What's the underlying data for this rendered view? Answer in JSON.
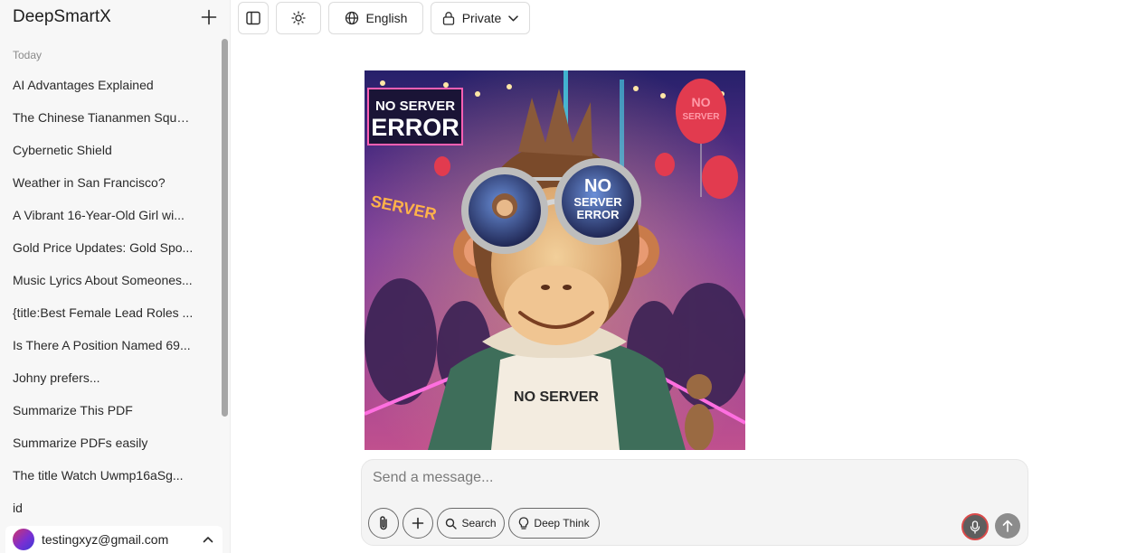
{
  "sidebar": {
    "app_title": "DeepSmartX",
    "group_label": "Today",
    "chats": [
      "AI Advantages Explained",
      "The Chinese Tiananmen Squa...",
      "Cybernetic Shield",
      "Weather in San Francisco?",
      "A Vibrant 16-Year-Old Girl wi...",
      "Gold Price Updates: Gold Spo...",
      "Music Lyrics About Someones...",
      "{title:Best Female Lead Roles ...",
      "Is There A Position Named 69...",
      "Johny prefers...",
      "Summarize This PDF",
      "Summarize PDFs easily",
      "The title Watch Uwmp16aSg...",
      "id"
    ],
    "user_email": "testingxyz@gmail.com"
  },
  "toolbar": {
    "language_label": "English",
    "visibility_label": "Private"
  },
  "image": {
    "sign_left_line1": "NO SERVER",
    "sign_left_line2": "ERROR",
    "lens_text_line1": "NO",
    "lens_text_line2": "SERVER",
    "lens_text_line3": "ERROR",
    "shirt_text": "NO SERVER",
    "balloon_text_line1": "NO",
    "balloon_text_line2": "SERVER",
    "side_sign_text": "SERVER"
  },
  "composer": {
    "placeholder": "Send a message...",
    "search_label": "Search",
    "deep_think_label": "Deep Think"
  },
  "colors": {
    "accent_mic_ring": "#d94a4a",
    "sidebar_bg": "#f7f7f7"
  }
}
